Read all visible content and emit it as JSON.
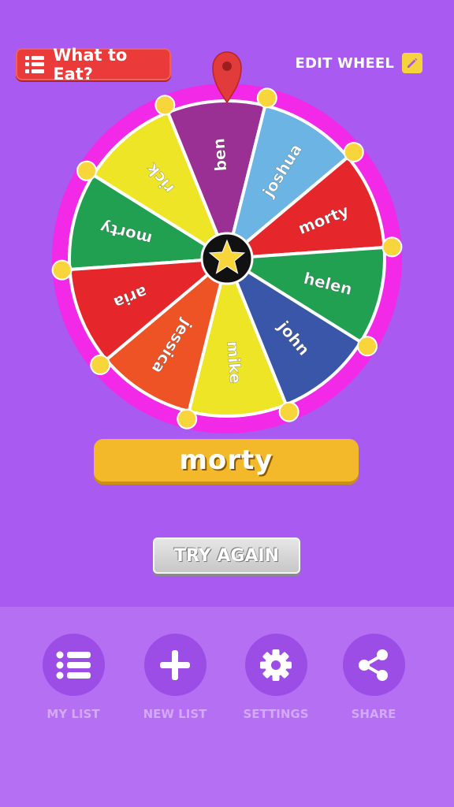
{
  "header": {
    "title": "What to Eat?",
    "edit_label": "EDIT WHEEL"
  },
  "wheel": {
    "segments": [
      {
        "label": "morty",
        "color": "#22a052"
      },
      {
        "label": "rick",
        "color": "#eee527"
      },
      {
        "label": "ben",
        "color": "#9a2f94"
      },
      {
        "label": "joshua",
        "color": "#6cb4e4"
      },
      {
        "label": "morty",
        "color": "#e5262b"
      },
      {
        "label": "helen",
        "color": "#22a052"
      },
      {
        "label": "john",
        "color": "#3a56a8"
      },
      {
        "label": "mike",
        "color": "#eee527"
      },
      {
        "label": "jessica",
        "color": "#ee5325"
      },
      {
        "label": "aria",
        "color": "#e5262b"
      }
    ],
    "rim_color": "#f229e6",
    "peg_color": "#f8d53a",
    "pointer_color": "#e23b3b",
    "center_icon": "star-icon"
  },
  "result": {
    "text": "morty"
  },
  "actions": {
    "try_again": "TRY AGAIN"
  },
  "nav": [
    {
      "label": "MY LIST",
      "icon": "list-icon"
    },
    {
      "label": "NEW LIST",
      "icon": "plus-icon"
    },
    {
      "label": "SETTINGS",
      "icon": "gear-icon"
    },
    {
      "label": "SHARE",
      "icon": "share-icon"
    }
  ]
}
